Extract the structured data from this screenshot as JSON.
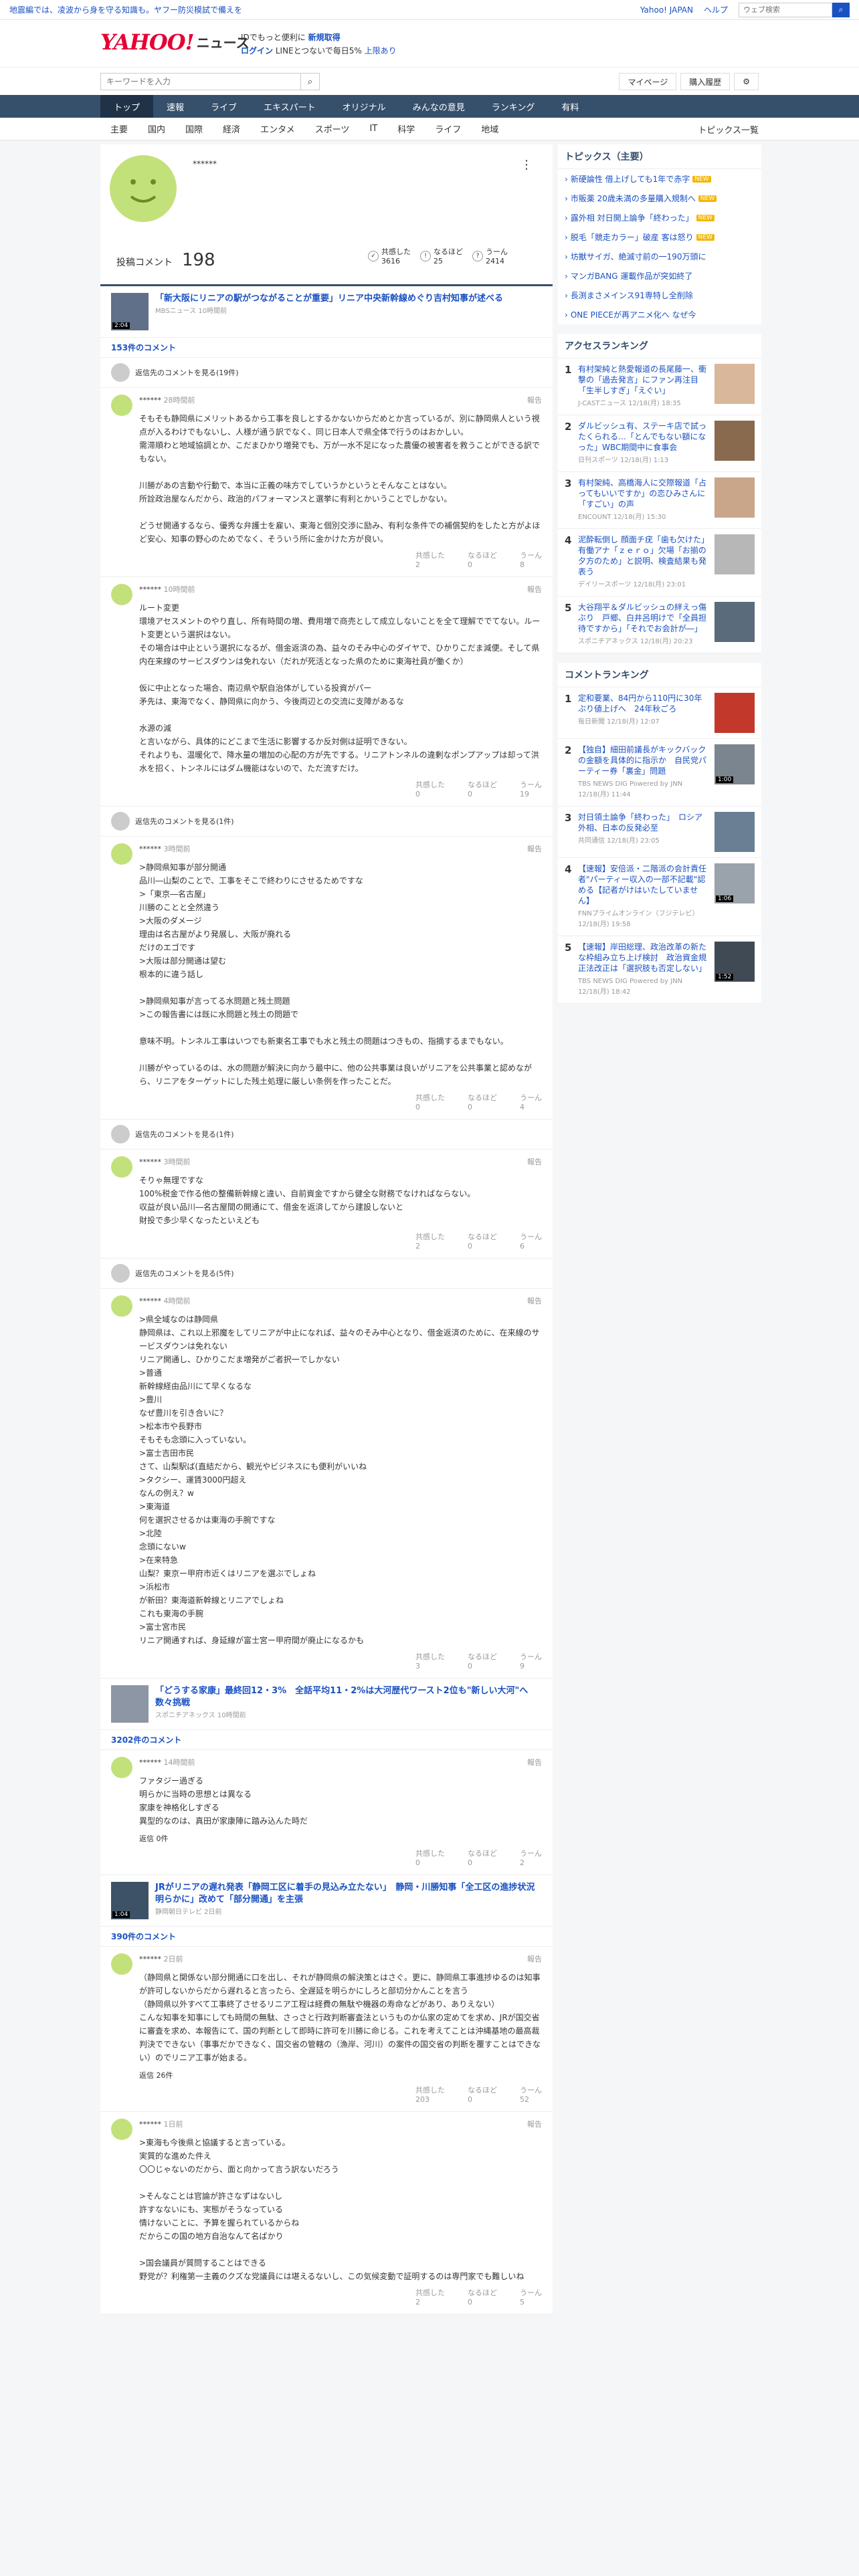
{
  "topbar": {
    "notice": "地震編では、凌波から身を守る知識も。ヤフー防災模試で備えを",
    "links": [
      "Yahoo! JAPAN",
      "ヘルプ"
    ],
    "search_placeholder": "ウェブ検索"
  },
  "header": {
    "logo": "YAHOO!",
    "logo_sub": "JAPAN",
    "brand": "ニュース",
    "promo1a": "IDでもっと便利に",
    "promo1b": "新規取得",
    "promo2a": "ログイン",
    "promo2b": "LINEとつないで毎日5%",
    "promo2c": "上限あり"
  },
  "search": {
    "placeholder": "キーワードを入力",
    "btn1": "マイページ",
    "btn2": "購入履歴"
  },
  "nav": [
    "トップ",
    "速報",
    "ライブ",
    "エキスパート",
    "オリジナル",
    "みんなの意見",
    "ランキング",
    "有料"
  ],
  "subnav": [
    "主要",
    "国内",
    "国際",
    "経済",
    "エンタメ",
    "スポーツ",
    "IT",
    "科学",
    "ライフ",
    "地域"
  ],
  "subnav_right": "トピックス一覧",
  "profile": {
    "name": "******",
    "comments_label": "投稿コメント",
    "comments_count": "198",
    "stats": [
      {
        "label": "共感した",
        "val": "3616"
      },
      {
        "label": "なるほど",
        "val": "25"
      },
      {
        "label": "うーん",
        "val": "2414"
      }
    ]
  },
  "articles": [
    {
      "title": "「新大阪にリニアの駅がつながることが重要」リニア中央新幹線めぐり吉村知事が述べる",
      "src": "MBSニュース 10時間前",
      "dur": "2:04",
      "count": "153件のコメント",
      "reply": "返信先のコメントを見る(19件)",
      "comments": [
        {
          "name": "******",
          "time": "28時間前",
          "report": "報告",
          "body": "そもそも静岡県にメリットあるから工事を良しとするかないからだめとか言っているが、別に静岡県人という視点が入るわけでもないし、人様が通う訳でなく、同じ日本人で県全体で行うのはおかしい。\n需滞順わと地域協調とか、こだまひかり増発でも、万が一水不足になった農優の被害者を救うことができる訳でもない。\n\n川勝があの言動や行動で、本当に正義の味方でしていうかというとそんなことはない。\n所詮政治屋なんだから、政治的パフォーマンスと選挙に有利とかいうことでしかない。\n\nどうせ開通するなら、優秀な弁護士を雇い、東海と個別交渉に励み、有利な条件での補償契約をしたと方がよほど安心、知事の野心のためでなく、そういう所に金かけた方が良い。",
          "a": [
            "2",
            "0",
            "8"
          ]
        },
        {
          "name": "******",
          "time": "10時間前",
          "report": "報告",
          "body": "ルート変更\n環境アセスメントのやり直し、所有時間の増、費用増で商売として成立しないことを全て理解ででてない。ルート変更という選択はない。\nその場合は中止という選択になるが、借金返済の為、益々のそみ中心のダイヤで、ひかりこだま減便。そして県内在来線のサービスダウンは免れない（だれが死活となった県のために東海社員が働くか）\n\n仮に中止となった場合、南辺県や駅自治体がしている投資がパー\n矛先は、東海でなく、静岡県に向かう、今後両辺との交流に支障があるな\n\n水源の減\nと言いながら、具体的にどこまで生活に影響するか反対側は証明できない。\nそれよりも、温暖化で、降水量の増加の心配の方が先でする。リニアトンネルの違剰なポンプアップは却って洪水を招く、トンネルにはダム機能はないので、ただ流すだけ。",
          "a": [
            "0",
            "0",
            "19"
          ]
        }
      ]
    },
    {
      "reply": "返信先のコメントを見る(1件)",
      "comments": [
        {
          "name": "******",
          "time": "3時間前",
          "report": "報告",
          "body": ">静岡県知事が部分開通\n品川―山梨のことで、工事をそこで終わりにさせるためですな\n>「東京―名古屋」\n川勝のことと全然違う\n>大阪のダメージ\n理由は名古屋がより発展し、大阪が廃れる\nだけのエゴです\n>大阪は部分開通は望む\n根本的に違う話し\n\n>静岡県知事が言ってる水問題と残土問題\n>この報告書には既に水問題と残土の問題で\n\n意味不明。トンネル工事はいつでも新東名工事でも水と残土の問題はつきもの、指摘するまでもない。\n\n川勝がやっているのは、水の問題が解決に向かう最中に、他の公共事業は良いがリニアを公共事業と認めながら、リニアをターゲットにした残土処理に厳しい条例を作ったことだ。",
          "a": [
            "0",
            "0",
            "4"
          ]
        }
      ]
    },
    {
      "reply": "返信先のコメントを見る(1件)",
      "comments": [
        {
          "name": "******",
          "time": "3時間前",
          "report": "報告",
          "body": "そりゃ無理ですな\n100%税金で作る他の整備新幹線と違い、自前資金ですから健全な財務でなければならない。\n収益が良い品川―名古屋間の開通にて、借金を返済してから建設しないと\n財投で多少早くなったといえども",
          "a": [
            "2",
            "0",
            "6"
          ]
        }
      ]
    },
    {
      "reply": "返信先のコメントを見る(5件)",
      "comments": [
        {
          "name": "******",
          "time": "4時間前",
          "report": "報告",
          "body": ">県全域なのは静岡県\n静岡県は、これ以上邪魔をしてリニアが中止になれば、益々のそみ中心となり、借金返済のために、在来線のサービスダウンは免れない\nリニア開通し、ひかりこだま増発がご者択一でしかない\n>普通\n新幹線経由品川にて早くなるな\n>豊川\nなぜ豊川を引き合いに？\n>松本市や長野市\nそもそも念頭に入っていない。\n>富士吉田市民\nさて、山梨駅ば(直結だから、観光やビジネスにも便利がいいね\n>タクシー、運賃3000円超え\nなんの例え？w\n>東海道\n何を選択させるかは東海の手腕ですな\n>北陸\n念頭にないw\n>在来特急\n山梨？東京ー甲府市近くはリニアを選ぶでしょね\n>浜松市\nが新田？東海道新幹線とリニアでしょね\nこれも東海の手腕\n>富士宮市民\nリニア開通すれば、身延線が富士宮ー甲府間が廃止になるかも",
          "a": [
            "3",
            "0",
            "9"
          ]
        }
      ]
    },
    {
      "title": "「どうする家康」最終回12・3%　全話平均11・2%は大河歴代ワースト2位も\"新しい大河\"へ数々挑戦",
      "src": "スポニチアネックス 10時間前",
      "count": "3202件のコメント",
      "comments": [
        {
          "name": "******",
          "time": "14時間前",
          "report": "報告",
          "body": "ファタジー過ぎる\n明らかに当時の思想とは異なる\n家康を神格化しすぎる\n異型的なのは、真田が家康陣に踏み込んた時だ",
          "replies": "返信 0件",
          "a": [
            "0",
            "0",
            "2"
          ]
        }
      ]
    },
    {
      "title": "JRがリニアの遅れ発表「静岡工区に着手の見込み立たない」　静岡・川勝知事「全工区の進捗状況明らかに」改めて「部分開通」を主張",
      "src": "静岡朝日テレビ 2日前",
      "dur": "1:04",
      "count": "390件のコメント",
      "comments": [
        {
          "name": "******",
          "time": "2日前",
          "report": "報告",
          "body": "（静岡県と関係ない部分開通に口を出し、それが静岡県の解決策とはさぐ。更に、静岡県工事進捗ゆるのは知事が許可しないからだから遅れると言ったら、全遅延を明らかにしろと部切分かんことを言う\n（静岡県以外すべて工事終了させるリニア工程は経費の無駄や機器の寿命などがあり、ありえない）\nこんな知事を知事にしても時間の無駄、さっさと行政判断審査法というものか仏家の定めてを求め、JRが国交省に審査を求め、本報告にて、国の判断として即時に許可を川勝に命じる。これを考えてことは沖縄基地の最高裁判決でできない（事事だかできなく、国交省の管轄の（漁岸、河川）の案件の国交省の判断を覆すことはできない）のでリニア工事が始まる。",
          "replies": "返信 26件",
          "a": [
            "203",
            "0",
            "52"
          ]
        },
        {
          "name": "******",
          "time": "1日前",
          "report": "報告",
          "body": ">東海も今後県と協議すると言っている。\n実質的な進めた件え\n〇〇じゃないのだから、面と向かって言う訳ないだろう\n\n>そんなことは官論が許さなずはないし\n許すなないにも、実態がそうなっている\n情けないことに、予算を握られているからね\nだからこの国の地方自治なんて名ばかり\n\n>国会議員が質問することはできる\n野党が？利権第一主義のクズな党議員には堪えるないし、この気候変動で証明するのは専門家でも難しいね",
          "a": [
            "2",
            "0",
            "5"
          ]
        }
      ]
    }
  ],
  "side": {
    "topics_title": "トピックス（主要）",
    "topics": [
      {
        "t": "新硬論性 借上げしても1年で赤字",
        "n": "NEW"
      },
      {
        "t": "市販薬 20歳未満の多量購入規制へ",
        "n": "NEW"
      },
      {
        "t": "露外相 対日開上論争「終わった」",
        "n": "NEW"
      },
      {
        "t": "脱毛「競走カラー」破産 客は怒り",
        "n": "NEW"
      },
      {
        "t": "坊獣サイガ、絶滅寸前の一190万頭に",
        "n": ""
      },
      {
        "t": "マンガBANG 運載作品が突如終了",
        "n": ""
      },
      {
        "t": "長渕まさメインス91専特し全削除",
        "n": ""
      },
      {
        "t": "ONE PIECEが再アニメ化へ なぜ今",
        "n": ""
      }
    ],
    "access_title": "アクセスランキング",
    "access": [
      {
        "n": "1",
        "t": "有村架純と熱愛報道の長尾藤一、衝撃の「過去発言」にファン再注目「生半しすぎ」「えぐい」",
        "m": "J-CASTニュース 12/18(月) 18:35"
      },
      {
        "n": "2",
        "t": "ダルビッシュ有、ステーキ店で試ったくられる…「とんでもない額になった」WBC期間中に食事会",
        "m": "日刊スポーツ 12/18(月) 1:13"
      },
      {
        "n": "3",
        "t": "有村架純、高橋海人に交際報道「占ってもいいですか」の恋ひみさんに「すごい」の声",
        "m": "ENCOUNT 12/18(月) 15:30"
      },
      {
        "n": "4",
        "t": "泥酔転倒し 顔面チ疣「歯も欠けた」有働アナ「ｚｅｒｏ」欠場「お揃の夕方のため」と説明、検査結果も発表う",
        "m": "デイリースポーツ 12/18(月) 23:01"
      },
      {
        "n": "5",
        "t": "大谷翔平＆ダルビッシュの絆えっ傷ぶり　戸郷、白井呂明けで「全員担待ですから」「それでお会計が―」",
        "m": "スポニチアネックス 12/18(月) 20:23"
      }
    ],
    "comment_title": "コメントランキング",
    "commentrank": [
      {
        "n": "1",
        "t": "定和要業、84円から110円に30年ぶり値上げへ　24年秋ごろ",
        "m": "毎日新聞 12/18(月) 12:07",
        "d": ""
      },
      {
        "n": "2",
        "t": "【独自】細田前議長がキックバックの金額を具体的に指示か　自民党パーティー券「裏金」問題",
        "m": "TBS NEWS DIG Powered by JNN 12/18(月) 11:44",
        "d": "1:00"
      },
      {
        "n": "3",
        "t": "対日領土論争「終わった」　ロシア外相、日本の反発必至",
        "m": "共同通信 12/18(月) 23:05",
        "d": ""
      },
      {
        "n": "4",
        "t": "【速報】安倍派・二階派の会計責任者\"パーティー収入の一部不記載\"認める【記者がけはいたしていません】",
        "m": "FNNプライムオンライン（フジテレビ） 12/18(月) 19:58",
        "d": "1:06"
      },
      {
        "n": "5",
        "t": "【速報】岸田総理、政治改革の新たな枠組み立ち上げ検討　政治資金規正法改正は「選択肢も否定しない」",
        "m": "TBS NEWS DIG Powered by JNN 12/18(月) 18:42",
        "d": "1:52"
      }
    ]
  }
}
